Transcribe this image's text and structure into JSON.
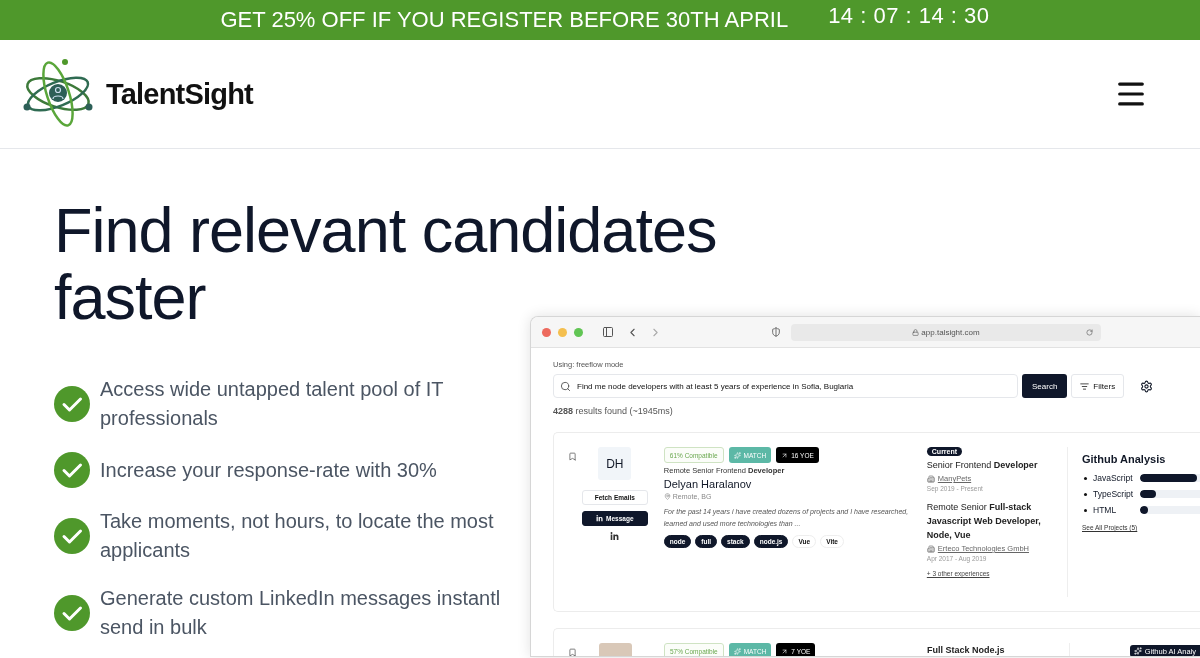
{
  "promo": {
    "text": "GET 25% OFF IF YOU REGISTER BEFORE 30TH APRIL",
    "countdown": "14 : 07 : 14 : 30"
  },
  "brand": "TalentSight",
  "headline": "Find relevant candidates faster",
  "features": [
    {
      "lines": [
        "Access wide untapped talent pool of IT",
        "professionals"
      ]
    },
    {
      "lines": [
        "Increase your response-rate with 30%"
      ]
    },
    {
      "lines": [
        "Take moments, not hours, to locate the most",
        "applicants"
      ]
    },
    {
      "lines": [
        "Generate custom LinkedIn messages instantl",
        "send in bulk"
      ]
    }
  ],
  "browser": {
    "url": "app.talsight.com"
  },
  "app": {
    "mode": "Using: freeflow mode",
    "query": "Find me node developers with at least 5 years of experience in Sofia, Buglaria",
    "search_button": "Search",
    "filters_button": "Filters",
    "results": "**4288** results found (~1945ms)"
  },
  "candidates": [
    {
      "photo": false,
      "initials": "DH",
      "fetch_button": "Fetch Emails",
      "message_button": "Message",
      "compat": "61% Compatible",
      "match": "MATCH",
      "yoe": "16 YOE",
      "headline": "Remote Senior Frontend **Developer**",
      "name": "Delyan Haralanov",
      "location": "Remote, BG",
      "summary": "For the past 14 years i have created dozens of projects and I have researched, learned and used more technologies than ...",
      "tags": [
        {
          "label": "node",
          "matched": true
        },
        {
          "label": "full",
          "matched": true
        },
        {
          "label": "stack",
          "matched": true
        },
        {
          "label": "node.js",
          "matched": true
        },
        {
          "label": "Vue",
          "matched": false
        },
        {
          "label": "Vite",
          "matched": false
        }
      ],
      "experiences": [
        {
          "current": true,
          "badge": "Current",
          "title": "Senior Frontend **Developer**",
          "company": "ManyPets",
          "dates": "Sep 2019 - Present"
        },
        {
          "title": "Remote Senior **Full-stack Javascript Web Developer, Node, Vue**",
          "company": "Erteco Technologies GmbH",
          "dates": "Apr 2017 - Aug 2019"
        }
      ],
      "more": "+ 3 other experiences",
      "github": {
        "title": "Github Analysis",
        "languages": [
          {
            "name": "JavaScript",
            "level": 0.95
          },
          {
            "name": "TypeScript",
            "level": 0.27
          },
          {
            "name": "HTML",
            "level": 0.13
          }
        ],
        "link": "See All Projects (5)"
      }
    },
    {
      "photo": true,
      "compat": "57% Compatible",
      "match": "MATCH",
      "yoe": "7 YOE",
      "experiences": [
        {
          "title": "**Full Stack Node.js**"
        }
      ],
      "github_button": "Github AI Analy"
    }
  ]
}
